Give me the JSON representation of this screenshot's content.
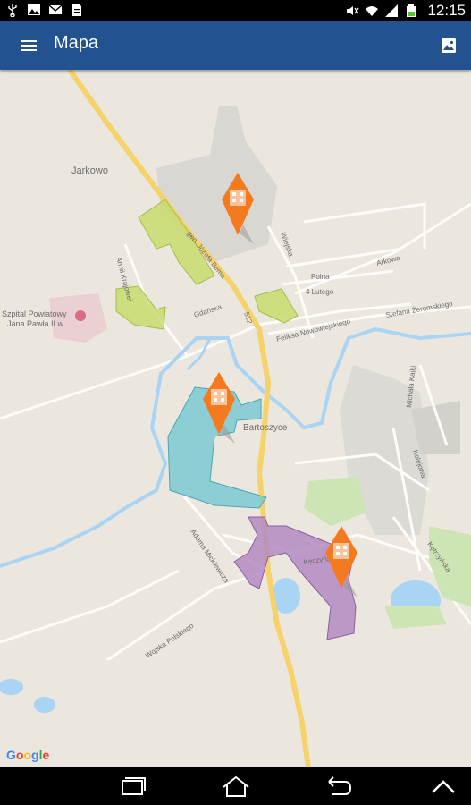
{
  "status_bar": {
    "time": "12:15",
    "left_icons": [
      "usb-icon",
      "image-icon",
      "mail-icon",
      "document-icon"
    ],
    "right_icons": [
      "mute-icon",
      "wifi-icon",
      "signal-icon",
      "battery-icon"
    ]
  },
  "app_bar": {
    "title": "Mapa",
    "menu_icon": "menu-icon",
    "action_icon": "map-layers-icon",
    "color": "#22528f"
  },
  "map": {
    "labels": {
      "jarkowo": "Jarkowo",
      "hospital_1": "Szpital Powiatowy",
      "hospital_2": "Jana Pawła II w...",
      "bema": "gen. Józefa Bema",
      "welska": "Wiejska",
      "polna": "Polna",
      "lutego": "4 Lutego",
      "arkowa": "Arkowa",
      "gdanska": "Gdańska",
      "road_512": "512",
      "nowowiejskiego": "Feliksa Nowowiejskiego",
      "zeromskiego": "Stefana Żeromskiego",
      "bartoszyce": "Bartoszyce",
      "armii_krajowej": "Armii Krajowej",
      "mickiewicza": "Adama Mickiewicza",
      "kolejowa": "Kolejowa",
      "kajki": "Michała Kajki",
      "kętrzyńska": "Kętrzyńska",
      "wojska_polskiego": "Wojska Polskiego",
      "keczynska": "Kęczyńska"
    },
    "markers": [
      "building-marker",
      "building-marker",
      "building-marker"
    ],
    "zone_colors": {
      "green": "#c8dc6e",
      "cyan": "#7cc9d3",
      "purple": "#b489c2",
      "marker": "#f37a1f",
      "water": "#a9d4f4",
      "road_major": "#f6d26b"
    },
    "attribution": "Google"
  },
  "nav_bar": {
    "icons": [
      "recent-apps-icon",
      "home-icon",
      "back-icon",
      "up-icon"
    ]
  }
}
